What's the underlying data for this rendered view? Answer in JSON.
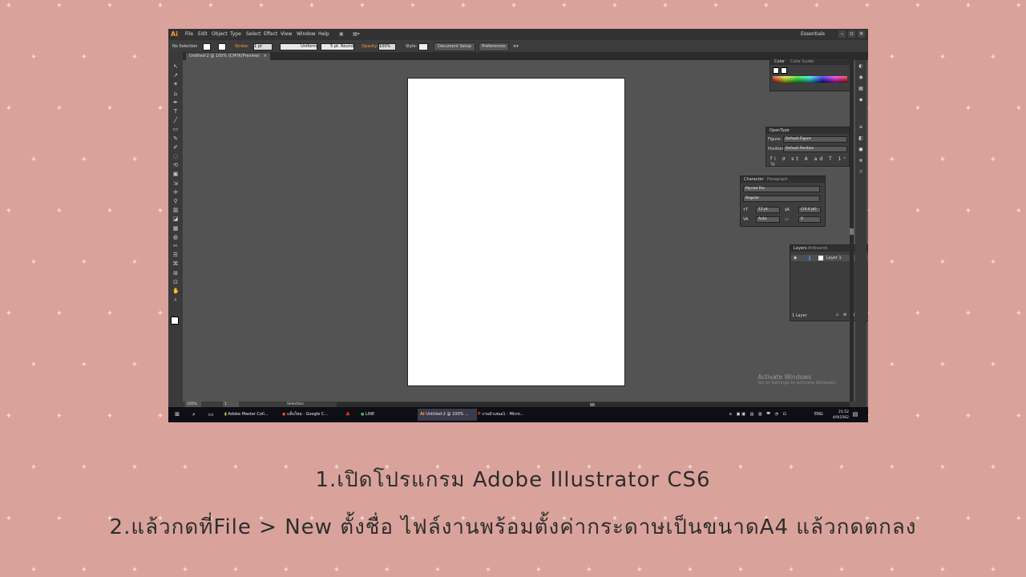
{
  "menubar": {
    "logo": "Ai",
    "menus": [
      "File",
      "Edit",
      "Object",
      "Type",
      "Select",
      "Effect",
      "View",
      "Window",
      "Help"
    ],
    "workspace": "Essentials",
    "window_buttons": [
      "–",
      "▫",
      "×"
    ]
  },
  "control_bar": {
    "selection": "No Selection",
    "stroke_label": "Stroke:",
    "stroke_value": "1 pt",
    "profile": "Uniform",
    "brush": "5 pt. Round",
    "opacity_label": "Opacity:",
    "opacity_value": "100%",
    "style_label": "Style:",
    "document_setup": "Document Setup",
    "preferences": "Preferences"
  },
  "document_tab": {
    "title": "Untitled-2 @ 100% (CMYK/Preview)",
    "close": "×"
  },
  "color_panel": {
    "tabs": [
      "Color",
      "Color Guide"
    ]
  },
  "opentype_panel": {
    "tab": "OpenType",
    "figure_label": "Figure:",
    "figure_value": "Default Figure",
    "position_label": "Position:",
    "position_value": "Default Position"
  },
  "character_panel": {
    "tabs": [
      "Character",
      "Paragraph"
    ],
    "font": "Myriad Pro",
    "style": "Regular",
    "size": "12 pt",
    "leading": "(14.4 pt)",
    "kerning": "Auto",
    "tracking": "0"
  },
  "layers_panel": {
    "tabs": [
      "Layers",
      "Artboards"
    ],
    "layer_name": "Layer 1",
    "footer": "1 Layer"
  },
  "status_bar": {
    "zoom": "100%",
    "page": "1",
    "tool": "Selection"
  },
  "watermark": {
    "title": "Activate Windows",
    "subtitle": "Go to Settings to activate Windows."
  },
  "taskbar": {
    "items": [
      "Adobe Master Coll...",
      "แท็บใหม่ - Google C...",
      "LINE",
      "Untitled-2 @ 100% ...",
      "งานนำเสนอ1 - Micro..."
    ],
    "lang": "ENG",
    "time": "21:52",
    "date": "4/9/2562"
  },
  "captions": {
    "line1": "1.เปิดโปรแกรม  Adobe  Illustrator  CS6",
    "line2": "2.แล้วกดที่File  >  New  ตั้งชื่อ  ไฟล์งานพร้อมตั้งค่ากระดาษเป็นขนาดA4  แล้วกดตกลง"
  }
}
